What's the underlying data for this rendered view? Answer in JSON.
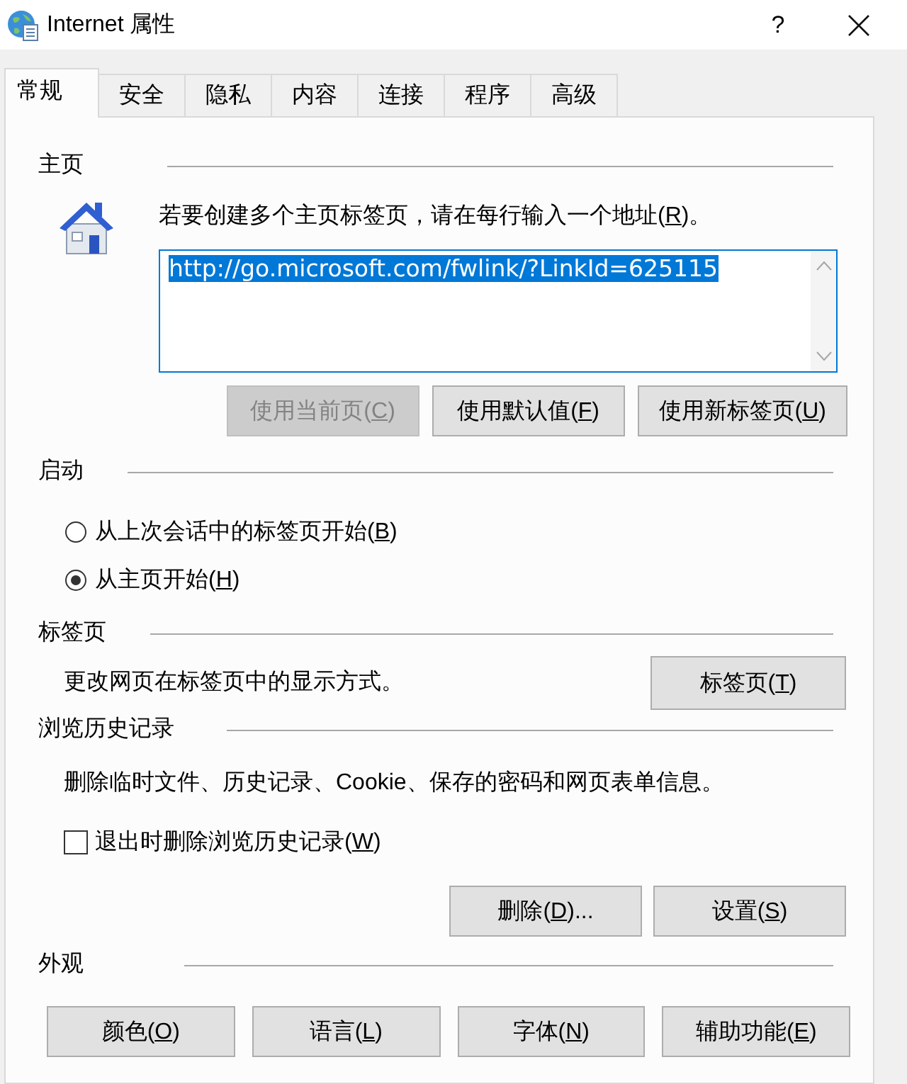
{
  "window": {
    "title": "Internet 属性",
    "help_button": "?"
  },
  "tabs": [
    {
      "label": "常规",
      "selected": true
    },
    {
      "label": "安全",
      "selected": false
    },
    {
      "label": "隐私",
      "selected": false
    },
    {
      "label": "内容",
      "selected": false
    },
    {
      "label": "连接",
      "selected": false
    },
    {
      "label": "程序",
      "selected": false
    },
    {
      "label": "高级",
      "selected": false
    }
  ],
  "home_page": {
    "heading": "主页",
    "instruction": "若要创建多个主页标签页，请在每行输入一个地址(R)。",
    "address": {
      "value": "http://go.microsoft.com/fwlink/?LinkId=625115",
      "selected": true
    },
    "buttons": [
      {
        "label": "使用当前页(C)",
        "disabled": true
      },
      {
        "label": "使用默认值(F)",
        "disabled": false
      },
      {
        "label": "使用新标签页(U)",
        "disabled": false
      }
    ]
  },
  "startup": {
    "heading": "启动",
    "options": [
      {
        "label": "从上次会话中的标签页开始(B)",
        "selected": false
      },
      {
        "label": "从主页开始(H)",
        "selected": true
      }
    ]
  },
  "tab_settings": {
    "heading": "标签页",
    "description": "更改网页在标签页中的显示方式。",
    "button": {
      "label": "标签页(T)",
      "disabled": false
    }
  },
  "browsing_history": {
    "heading": "浏览历史记录",
    "description": "删除临时文件、历史记录、Cookie、保存的密码和网页表单信息。",
    "delete_on_exit": {
      "label": "退出时删除浏览历史记录(W)",
      "checked": false
    },
    "buttons": [
      {
        "label": "删除(D)...",
        "disabled": false
      },
      {
        "label": "设置(S)",
        "disabled": false
      }
    ]
  },
  "appearance": {
    "heading": "外观",
    "buttons": [
      {
        "label": "颜色(O)",
        "disabled": false
      },
      {
        "label": "语言(L)",
        "disabled": false
      },
      {
        "label": "字体(N)",
        "disabled": false
      },
      {
        "label": "辅助功能(E)",
        "disabled": false
      }
    ]
  }
}
